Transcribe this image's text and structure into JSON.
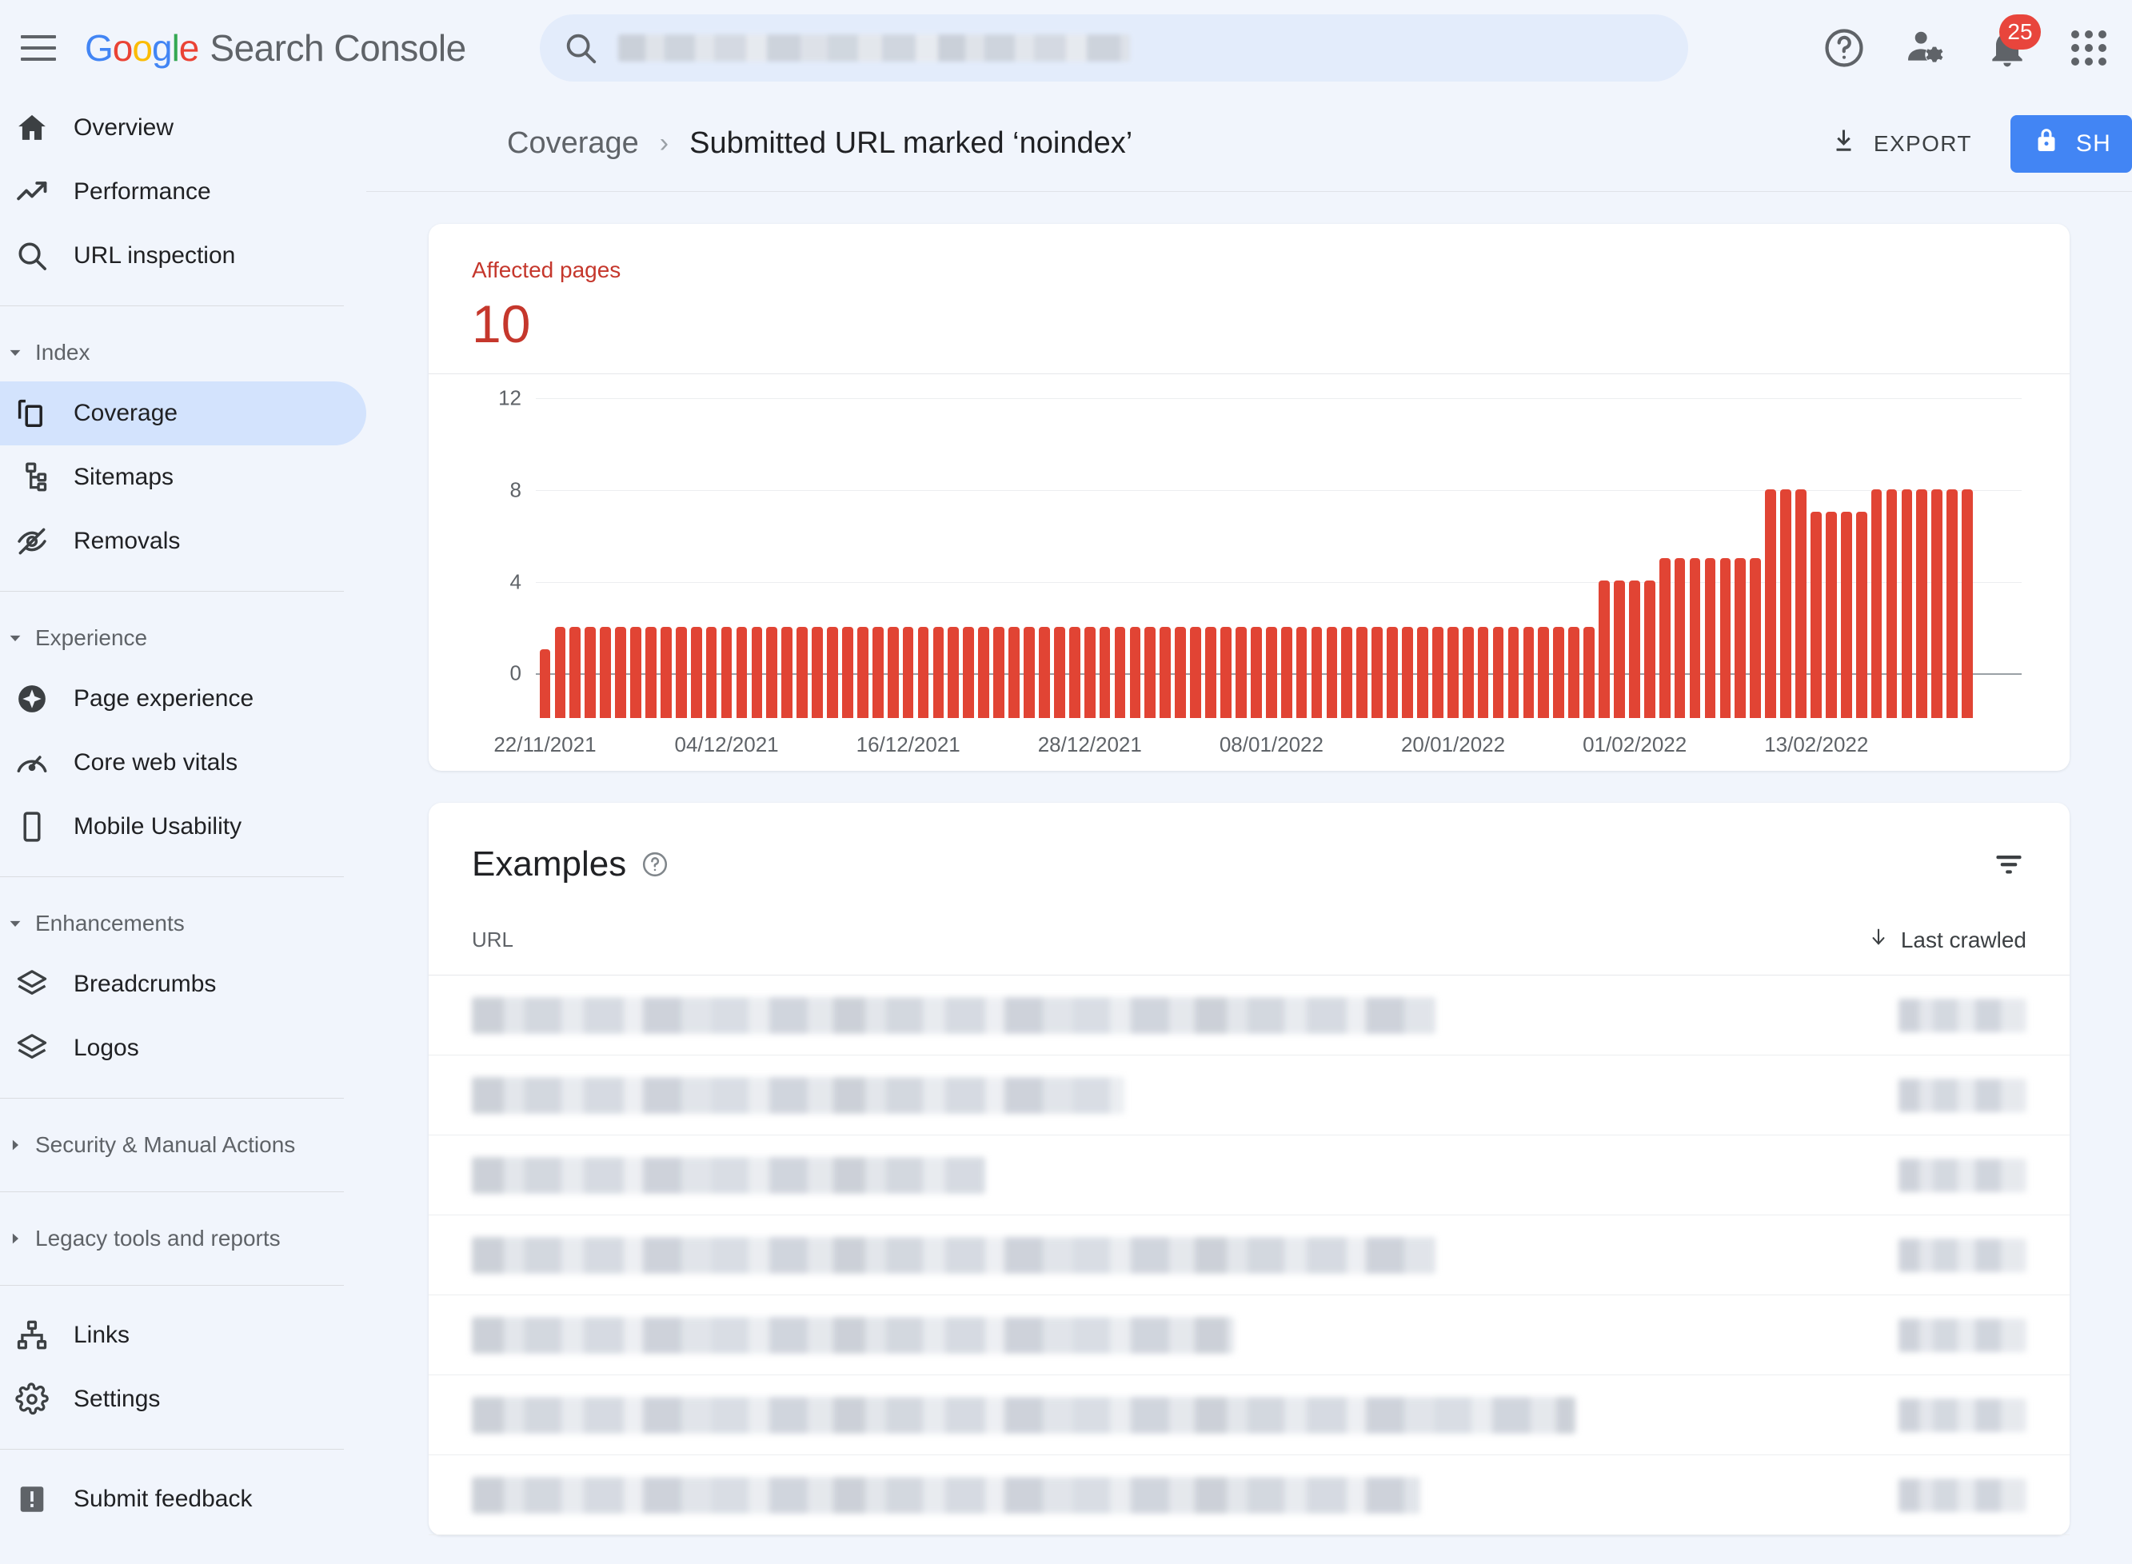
{
  "app": {
    "brand_google": "Google",
    "brand_rest": "Search Console"
  },
  "search": {
    "placeholder": "",
    "value": "",
    "icon": "search-icon",
    "redacted": true
  },
  "top_actions": {
    "help_label": "Help",
    "users_label": "Users and permissions",
    "notifications_count": "25",
    "apps_label": "Google apps"
  },
  "sidebar": {
    "items": [
      {
        "label": "Overview",
        "icon": "home-icon",
        "type": "item",
        "active": false
      },
      {
        "label": "Performance",
        "icon": "trending-up-icon",
        "type": "item",
        "active": false
      },
      {
        "label": "URL inspection",
        "icon": "search-icon",
        "type": "item",
        "active": false
      },
      {
        "label": "Index",
        "icon": "caret-down-icon",
        "type": "group",
        "expanded": true
      },
      {
        "label": "Coverage",
        "icon": "copy-pages-icon",
        "type": "item",
        "active": true
      },
      {
        "label": "Sitemaps",
        "icon": "sitemap-icon",
        "type": "item",
        "active": false
      },
      {
        "label": "Removals",
        "icon": "eye-off-icon",
        "type": "item",
        "active": false
      },
      {
        "label": "Experience",
        "icon": "caret-down-icon",
        "type": "group",
        "expanded": true
      },
      {
        "label": "Page experience",
        "icon": "page-experience-icon",
        "type": "item",
        "active": false
      },
      {
        "label": "Core web vitals",
        "icon": "speedometer-icon",
        "type": "item",
        "active": false
      },
      {
        "label": "Mobile Usability",
        "icon": "mobile-icon",
        "type": "item",
        "active": false
      },
      {
        "label": "Enhancements",
        "icon": "caret-down-icon",
        "type": "group",
        "expanded": true
      },
      {
        "label": "Breadcrumbs",
        "icon": "layers-icon",
        "type": "item",
        "active": false
      },
      {
        "label": "Logos",
        "icon": "layers-icon",
        "type": "item",
        "active": false
      },
      {
        "label": "Security & Manual Actions",
        "icon": "caret-right-icon",
        "type": "group",
        "expanded": false
      },
      {
        "label": "Legacy tools and reports",
        "icon": "caret-right-icon",
        "type": "group",
        "expanded": false
      },
      {
        "label": "Links",
        "icon": "links-icon",
        "type": "item",
        "active": false
      },
      {
        "label": "Settings",
        "icon": "gear-icon",
        "type": "item",
        "active": false
      },
      {
        "label": "Submit feedback",
        "icon": "feedback-icon",
        "type": "item",
        "active": false
      }
    ]
  },
  "header": {
    "breadcrumb_parent": "Coverage",
    "breadcrumb_separator": "›",
    "breadcrumb_current": "Submitted URL marked ‘noindex’",
    "export_label": "EXPORT",
    "share_label": "SH",
    "share_icon": "lock-icon",
    "export_icon": "download-icon"
  },
  "summary": {
    "affected_label": "Affected pages",
    "affected_value": "10",
    "accent_color": "#c5372c"
  },
  "chart_data": {
    "type": "bar",
    "title": "Affected pages",
    "xlabel": "",
    "ylabel": "",
    "ylim": [
      0,
      12
    ],
    "yticks": [
      0,
      4,
      8,
      12
    ],
    "ytick_labels": [
      "0",
      "4",
      "8",
      "12"
    ],
    "grid": true,
    "legend": "none",
    "bar_color": "#e14434",
    "xtick_labels": [
      "22/11/2021",
      "04/12/2021",
      "16/12/2021",
      "28/12/2021",
      "08/01/2022",
      "20/01/2022",
      "01/02/2022",
      "13/02/2022"
    ],
    "xtick_indices": [
      0,
      12,
      24,
      36,
      48,
      60,
      72,
      84
    ],
    "x_start": "22/11/2021",
    "x_end": "20/02/2022",
    "values": [
      3,
      4,
      4,
      4,
      4,
      4,
      4,
      4,
      4,
      4,
      4,
      4,
      4,
      4,
      4,
      4,
      4,
      4,
      4,
      4,
      4,
      4,
      4,
      4,
      4,
      4,
      4,
      4,
      4,
      4,
      4,
      4,
      4,
      4,
      4,
      4,
      4,
      4,
      4,
      4,
      4,
      4,
      4,
      4,
      4,
      4,
      4,
      4,
      4,
      4,
      4,
      4,
      4,
      4,
      4,
      4,
      4,
      4,
      4,
      4,
      4,
      4,
      4,
      4,
      4,
      4,
      4,
      4,
      4,
      4,
      6,
      6,
      6,
      6,
      7,
      7,
      7,
      7,
      7,
      7,
      7,
      10,
      10,
      10,
      9,
      9,
      9,
      9,
      10,
      10,
      10,
      10,
      10,
      10,
      10
    ]
  },
  "examples": {
    "title": "Examples",
    "help_icon": "help-circle-icon",
    "filter_icon": "filter-icon",
    "columns": {
      "url": "URL",
      "last_crawled": "Last crawled",
      "sort_icon": "arrow-down-icon"
    },
    "rows": [
      {
        "url": "",
        "last_crawled": "",
        "redacted": true,
        "url_width_pct": 62
      },
      {
        "url": "",
        "last_crawled": "",
        "redacted": true,
        "url_width_pct": 42
      },
      {
        "url": "",
        "last_crawled": "",
        "redacted": true,
        "url_width_pct": 33
      },
      {
        "url": "",
        "last_crawled": "",
        "redacted": true,
        "url_width_pct": 62
      },
      {
        "url": "",
        "last_crawled": "",
        "redacted": true,
        "url_width_pct": 49
      },
      {
        "url": "",
        "last_crawled": "",
        "redacted": true,
        "url_width_pct": 71
      },
      {
        "url": "",
        "last_crawled": "",
        "redacted": true,
        "url_width_pct": 61
      }
    ]
  }
}
